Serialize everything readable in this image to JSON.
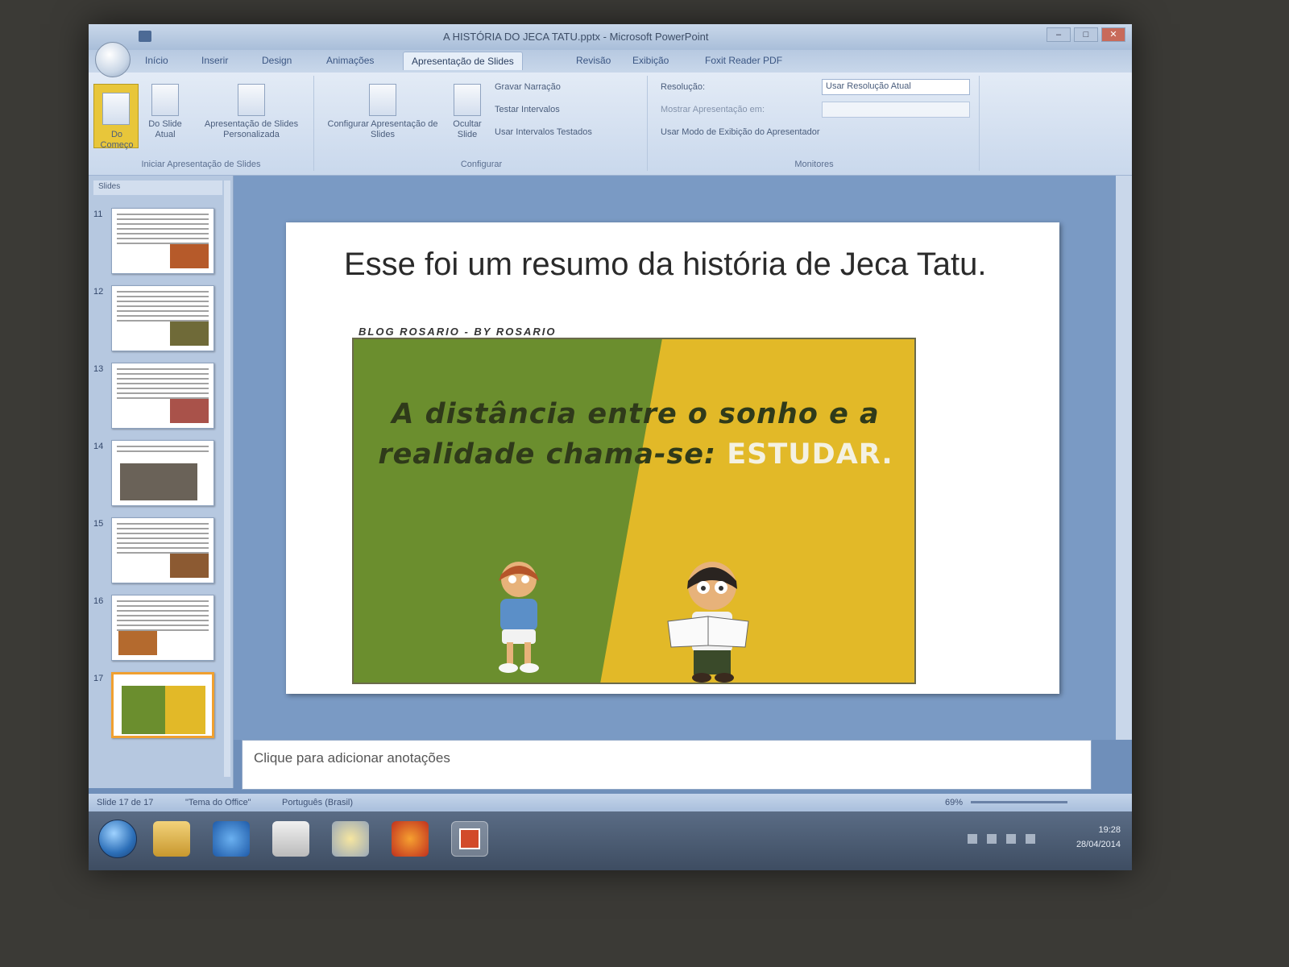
{
  "window": {
    "title": "A HISTÓRIA DO JECA TATU.pptx - Microsoft PowerPoint"
  },
  "tabs": [
    {
      "label": "Início"
    },
    {
      "label": "Inserir"
    },
    {
      "label": "Design"
    },
    {
      "label": "Animações"
    },
    {
      "label": "Apresentação de Slides",
      "active": true
    },
    {
      "label": "Revisão"
    },
    {
      "label": "Exibição"
    },
    {
      "label": "Foxit Reader PDF"
    }
  ],
  "ribbon": {
    "start_group": {
      "from_beginning": "Do Começo",
      "from_current": "Do Slide Atual",
      "custom": "Apresentação de Slides Personalizada",
      "label": "Iniciar Apresentação de Slides"
    },
    "setup_group": {
      "setup": "Configurar Apresentação de Slides",
      "hide": "Ocultar Slide",
      "record": "Gravar Narração",
      "rehearse": "Testar Intervalos",
      "use_timings": "Usar Intervalos Testados",
      "label": "Configurar"
    },
    "monitors_group": {
      "resolution": "Resolução:",
      "resolution_value": "Usar Resolução Atual",
      "show_on": "Mostrar Apresentação em:",
      "presenter_view": "Usar Modo de Exibição do Apresentador",
      "label": "Monitores"
    }
  },
  "slide_panel": {
    "tabs_label": "Slides",
    "thumbnails": [
      {
        "number": "11"
      },
      {
        "number": "12"
      },
      {
        "number": "13"
      },
      {
        "number": "14"
      },
      {
        "number": "15"
      },
      {
        "number": "16"
      },
      {
        "number": "17",
        "selected": true
      }
    ]
  },
  "slide": {
    "title": "Esse foi um resumo da história de Jeca Tatu.",
    "credit": "BLOG ROSARIO     - BY ROSARIO",
    "quote_part1": "A distância entre o sonho e a realidade chama-se: ",
    "quote_highlight": "ESTUDAR.",
    "colors": {
      "green": "#6b8e2e",
      "yellow": "#e2b928"
    }
  },
  "notes": {
    "placeholder": "Clique para adicionar anotações"
  },
  "statusbar": {
    "slide_info": "Slide 17 de 17",
    "theme": "\"Tema do Office\"",
    "language": "Português (Brasil)",
    "zoom": "69%"
  },
  "taskbar": {
    "time": "19:28",
    "date": "28/04/2014"
  }
}
